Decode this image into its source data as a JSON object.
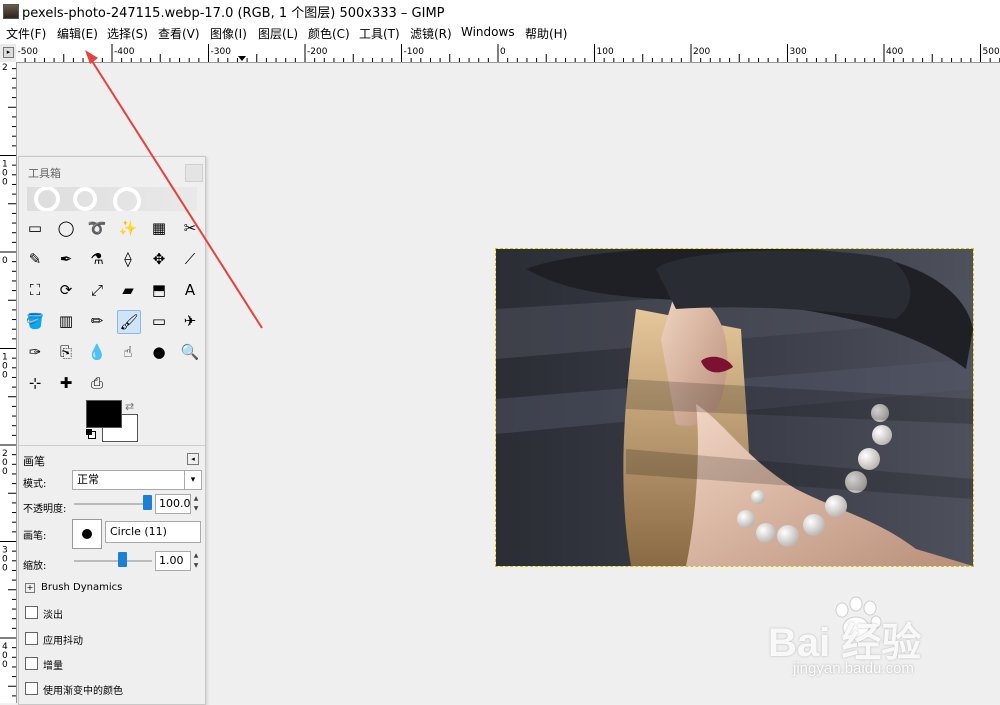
{
  "window": {
    "title": "pexels-photo-247115.webp-17.0 (RGB, 1 个图层) 500x333 – GIMP"
  },
  "menu": [
    {
      "label": "文件(F)",
      "name": "menu-file"
    },
    {
      "label": "编辑(E)",
      "name": "menu-edit"
    },
    {
      "label": "选择(S)",
      "name": "menu-select"
    },
    {
      "label": "查看(V)",
      "name": "menu-view"
    },
    {
      "label": "图像(I)",
      "name": "menu-image"
    },
    {
      "label": "图层(L)",
      "name": "menu-layer"
    },
    {
      "label": "颜色(C)",
      "name": "menu-colors"
    },
    {
      "label": "工具(T)",
      "name": "menu-tools"
    },
    {
      "label": "滤镜(R)",
      "name": "menu-filters"
    },
    {
      "label": "Windows",
      "name": "menu-windows"
    },
    {
      "label": "帮助(H)",
      "name": "menu-help"
    }
  ],
  "ruler": {
    "top_labels": [
      "-500",
      "-400",
      "-300",
      "-200",
      "-100",
      "0",
      "100",
      "200",
      "300",
      "400",
      "500"
    ],
    "left_labels": [
      "2",
      "1\n0\n0",
      "0",
      "1\n0\n0",
      "2\n0\n0",
      "3\n0\n0",
      "4\n0\n0"
    ]
  },
  "toolbox": {
    "title": "工具箱",
    "tools": [
      {
        "name": "rect-select-icon",
        "glyph": "▭"
      },
      {
        "name": "ellipse-select-icon",
        "glyph": "◯"
      },
      {
        "name": "free-select-icon",
        "glyph": "➰"
      },
      {
        "name": "fuzzy-select-icon",
        "glyph": "✨"
      },
      {
        "name": "select-by-color-icon",
        "glyph": "▦"
      },
      {
        "name": "scissors-select-icon",
        "glyph": "✂"
      },
      {
        "name": "foreground-select-icon",
        "glyph": "✎"
      },
      {
        "name": "paths-icon",
        "glyph": "✒"
      },
      {
        "name": "color-picker-icon",
        "glyph": "⚗"
      },
      {
        "name": "measure-icon",
        "glyph": "⟠"
      },
      {
        "name": "move-icon",
        "glyph": "✥"
      },
      {
        "name": "align-icon",
        "glyph": "⟋"
      },
      {
        "name": "crop-icon",
        "glyph": "⛶"
      },
      {
        "name": "rotate-icon",
        "glyph": "⟳"
      },
      {
        "name": "scale-icon",
        "glyph": "⤢"
      },
      {
        "name": "shear-icon",
        "glyph": "▰"
      },
      {
        "name": "perspective-icon",
        "glyph": "⬒"
      },
      {
        "name": "text-icon",
        "glyph": "A"
      },
      {
        "name": "bucket-fill-icon",
        "glyph": "🪣"
      },
      {
        "name": "gradient-icon",
        "glyph": "▥"
      },
      {
        "name": "pencil-icon",
        "glyph": "✏"
      },
      {
        "name": "paintbrush-icon",
        "glyph": "🖌"
      },
      {
        "name": "eraser-icon",
        "glyph": "▭"
      },
      {
        "name": "airbrush-icon",
        "glyph": "✈"
      },
      {
        "name": "ink-icon",
        "glyph": "✑"
      },
      {
        "name": "clone-icon",
        "glyph": "⎘"
      },
      {
        "name": "blur-icon",
        "glyph": "💧"
      },
      {
        "name": "smudge-icon",
        "glyph": "☝"
      },
      {
        "name": "dodge-burn-icon",
        "glyph": "●"
      },
      {
        "name": "zoom-icon",
        "glyph": "🔍"
      },
      {
        "name": "cage-transform-icon",
        "glyph": "⊹"
      },
      {
        "name": "heal-icon",
        "glyph": "✚"
      },
      {
        "name": "perspective-clone-icon",
        "glyph": "⎙"
      }
    ]
  },
  "tool_options": {
    "header": "画笔",
    "mode_label": "模式:",
    "mode_value": "正常",
    "opacity_label": "不透明度:",
    "opacity_value": "100.0",
    "opacity_fraction": 1.0,
    "brush_label": "画笔:",
    "brush_value": "Circle (11)",
    "scale_label": "缩放:",
    "scale_value": "1.00",
    "dynamics_label": "Brush Dynamics",
    "checkboxes": [
      "淡出",
      "应用抖动",
      "增量",
      "使用渐变中的颜色"
    ]
  },
  "watermark": {
    "brand": "Bai 经验",
    "url": "jingyan.baidu.com"
  },
  "colors": {
    "annotation_arrow": "#e8403a",
    "active_tool": "#cfe4f7",
    "slider": "#1e7fd6",
    "selection": "#d6c400"
  }
}
